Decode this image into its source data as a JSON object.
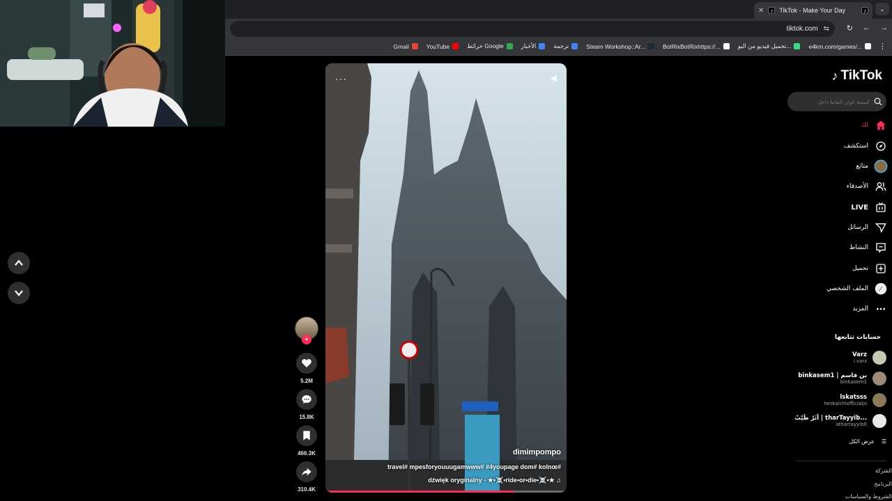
{
  "browser": {
    "tab_title": "TikTok - Make Your Day",
    "url": "tiktok.com",
    "bookmarks": [
      {
        "label": "Gmail",
        "color": "#ea4335"
      },
      {
        "label": "YouTube",
        "color": "#ff0000"
      },
      {
        "label": "خرائط Google",
        "color": "#34a853"
      },
      {
        "label": "الأخبار",
        "color": "#4285f4"
      },
      {
        "label": "ترجمة",
        "color": "#4285f4"
      },
      {
        "label": "Steam Workshop::Ar...",
        "color": "#1b2838"
      },
      {
        "label": "BotRixBotRixhttps://...",
        "color": "#ffffff"
      },
      {
        "label": "تحميل فيديو من اليو...",
        "color": "#3ddc84"
      },
      {
        "label": "e4km.com/games/...",
        "color": "#ffffff"
      }
    ]
  },
  "video": {
    "author": "dimimpompo",
    "description": "travel# mpesforyouuugamwww# #4youpage dom# kolnœ#",
    "music": "dźwięk oryginalny - ★•☠️•ride•or•die•☠️•★ ♫",
    "progress_percent": 78
  },
  "actions": {
    "likes": "5.2M",
    "comments": "15.8K",
    "saves": "466.3K",
    "shares": "310.4K"
  },
  "sidebar": {
    "logo": "TikTok",
    "search_placeholder": "كنيسة كولن المانيا داخل",
    "nav": [
      {
        "label": "لك",
        "icon": "home-icon"
      },
      {
        "label": "استكشف",
        "icon": "compass-icon"
      },
      {
        "label": "متابَع",
        "icon": "following-icon"
      },
      {
        "label": "الأصدقاء",
        "icon": "friends-icon"
      },
      {
        "label": "LIVE",
        "icon": "live-icon"
      },
      {
        "label": "الرسائل",
        "icon": "messages-icon"
      },
      {
        "label": "النشاط",
        "icon": "activity-icon"
      },
      {
        "label": "تحميل",
        "icon": "upload-icon"
      },
      {
        "label": "الملف الشخصي",
        "icon": "profile-icon"
      },
      {
        "label": "المزيد",
        "icon": "more-icon"
      }
    ],
    "following_title": "حسابات تتابعها",
    "accounts": [
      {
        "name": "Varz",
        "handle": "i.varz",
        "color": "#c8c8b0"
      },
      {
        "name": "binkasem1 | بن قاسم",
        "handle": "binkasem1",
        "color": "#a08878"
      },
      {
        "name": "lskatsss",
        "handle": "tenkaichiofficialjo",
        "color": "#8a7a5a"
      },
      {
        "name": "أثَرْ طَيّبْ | tharTayyib...",
        "handle": "athartayyib0",
        "color": "#e8e8e8"
      }
    ],
    "see_all": "عرض الكل",
    "footer": [
      "الشركة",
      "البرنامج",
      "الشروط والسياسات"
    ]
  }
}
